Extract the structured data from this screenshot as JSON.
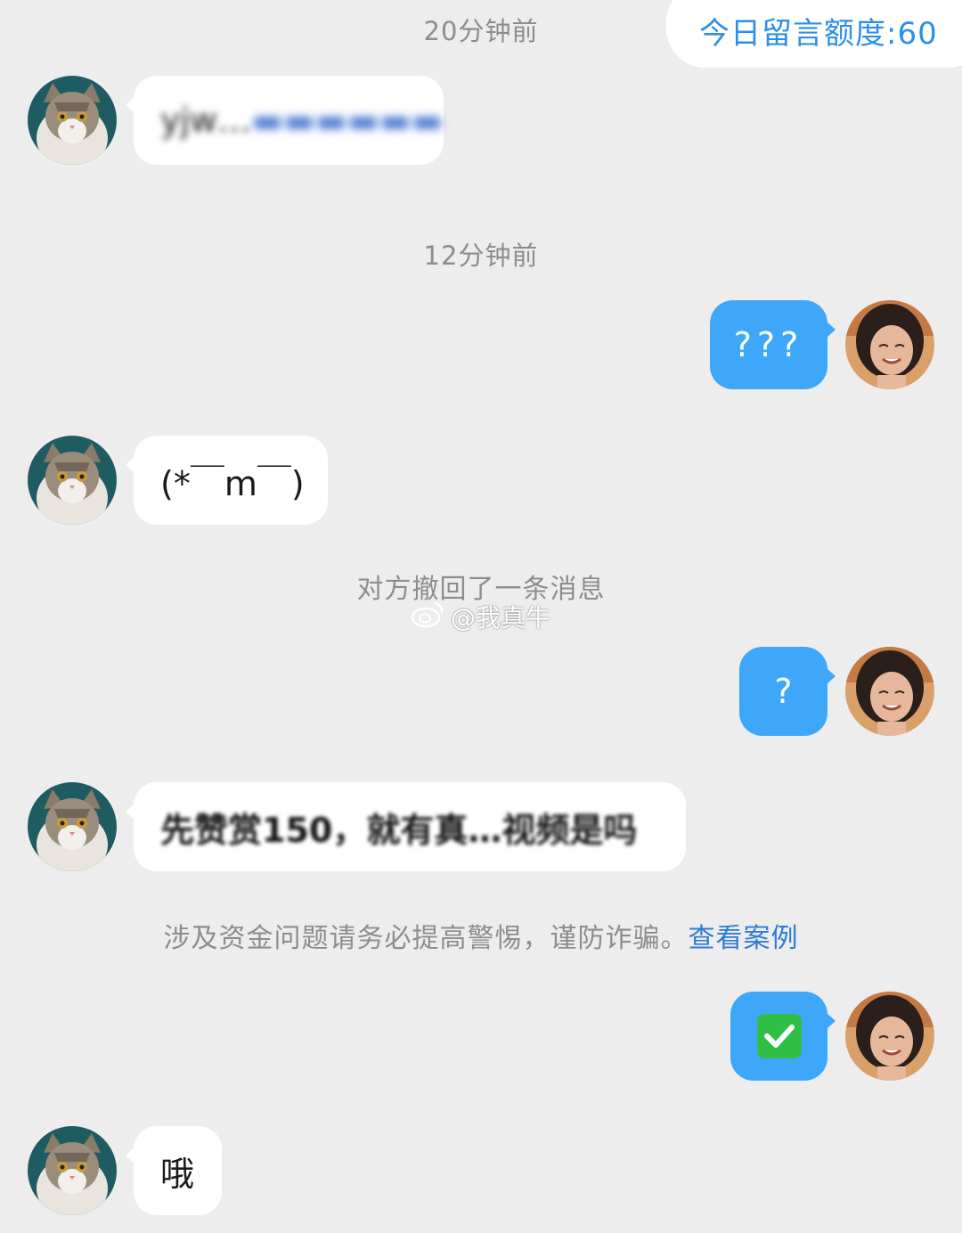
{
  "header": {
    "quota_label": "今日留言额度:60"
  },
  "timestamps": [
    "20分钟前",
    "12分钟前"
  ],
  "messages": [
    {
      "sender": "other",
      "text": "yjw…"
    },
    {
      "sender": "me",
      "text": "???"
    },
    {
      "sender": "other",
      "text": "(*￣m￣)"
    },
    {
      "sender": "me",
      "text": "?"
    },
    {
      "sender": "other",
      "text": "先赞赏150，就有真…视频是吗"
    },
    {
      "sender": "me",
      "text": "✅"
    },
    {
      "sender": "other",
      "text": "哦"
    }
  ],
  "recall_notice": "对方撤回了一条消息",
  "watermark": "@我真牛",
  "warning": {
    "text": "涉及资金问题请务必提高警惕，谨防诈骗。",
    "link": "查看案例"
  },
  "colors": {
    "background": "#ededed",
    "outgoing_bubble": "#3ea7f9",
    "incoming_bubble": "#ffffff",
    "link": "#2e7bd6",
    "quota_text": "#2e8fe8"
  },
  "icons": {
    "other_avatar": "cat-avatar-icon",
    "my_avatar": "user-avatar-icon",
    "check": "check-icon",
    "watermark": "weibo-icon"
  }
}
